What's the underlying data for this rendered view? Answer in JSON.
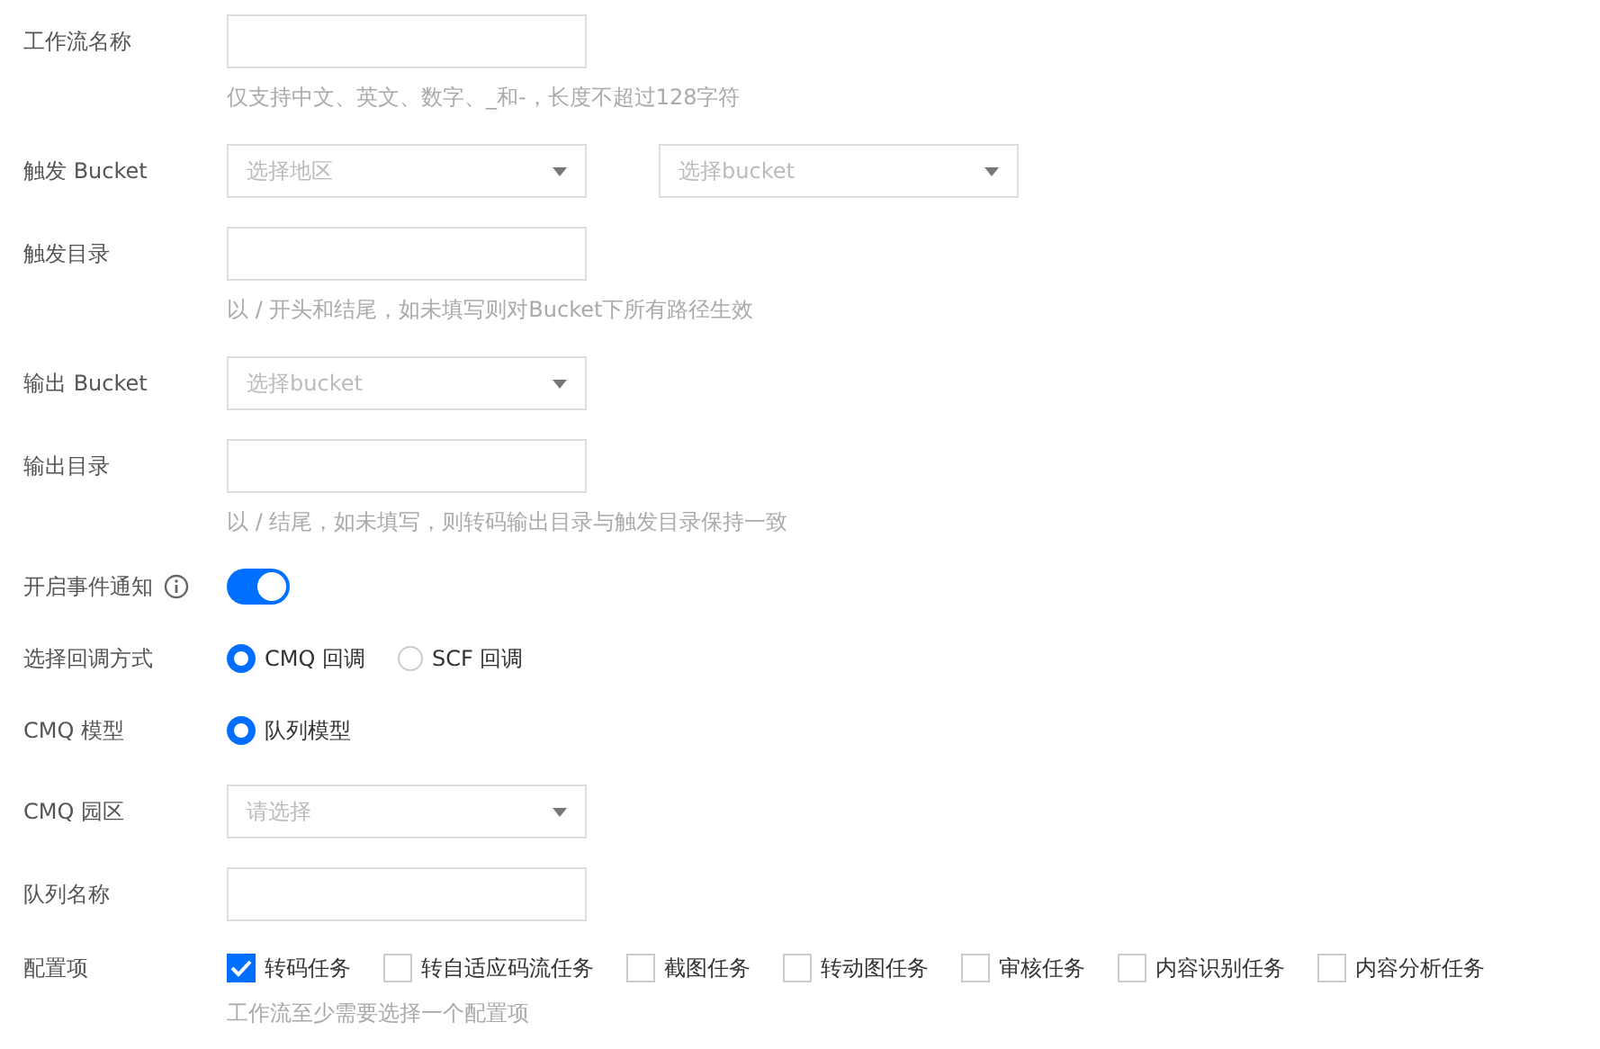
{
  "fields": [
    {
      "kind": "input",
      "label": "工作流名称",
      "hint": "仅支持中文、英文、数字、_和-，长度不超过128字符"
    },
    {
      "kind": "selects",
      "label": "触发 Bucket",
      "selects": [
        {
          "placeholder": "选择地区"
        },
        {
          "placeholder": "选择bucket"
        }
      ]
    },
    {
      "kind": "input",
      "label": "触发目录",
      "hint": "以 / 开头和结尾，如未填写则对Bucket下所有路径生效"
    },
    {
      "kind": "selects",
      "label": "输出 Bucket",
      "selects": [
        {
          "placeholder": "选择bucket"
        }
      ]
    },
    {
      "kind": "input",
      "label": "输出目录",
      "hint": "以 / 结尾，如未填写，则转码输出目录与触发目录保持一致"
    },
    {
      "kind": "toggle",
      "label": "开启事件通知",
      "info": true,
      "on": true
    },
    {
      "kind": "radio",
      "label": "选择回调方式",
      "options": [
        {
          "label": "CMQ 回调",
          "selected": true
        },
        {
          "label": "SCF 回调",
          "selected": false
        }
      ]
    },
    {
      "kind": "radio",
      "label": "CMQ 模型",
      "options": [
        {
          "label": "队列模型",
          "selected": true
        }
      ]
    },
    {
      "kind": "selects",
      "label": "CMQ 园区",
      "selects": [
        {
          "placeholder": "请选择"
        }
      ]
    },
    {
      "kind": "input",
      "label": "队列名称"
    },
    {
      "kind": "checks",
      "label": "配置项",
      "hint": "工作流至少需要选择一个配置项",
      "options": [
        {
          "label": "转码任务",
          "checked": true
        },
        {
          "label": "转自适应码流任务",
          "checked": false
        },
        {
          "label": "截图任务",
          "checked": false
        },
        {
          "label": "转动图任务",
          "checked": false
        },
        {
          "label": "审核任务",
          "checked": false
        },
        {
          "label": "内容识别任务",
          "checked": false
        },
        {
          "label": "内容分析任务",
          "checked": false
        }
      ]
    }
  ]
}
